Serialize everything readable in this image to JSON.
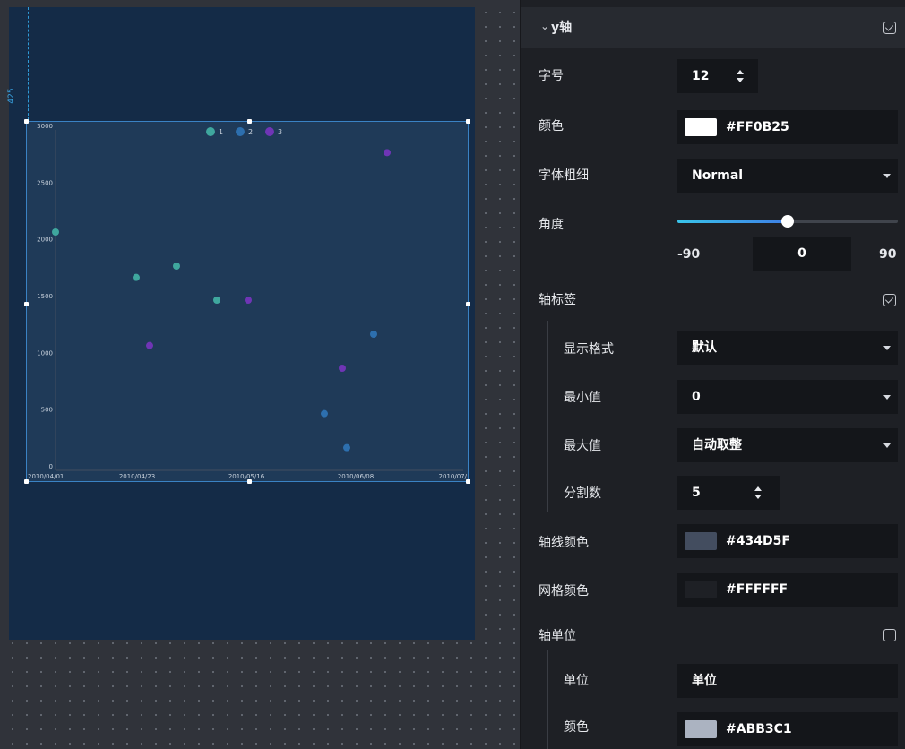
{
  "canvas": {
    "guide_label": "425"
  },
  "chart_data": {
    "type": "scatter",
    "x_tick_labels": [
      "2010/04/01",
      "2010/04/23",
      "2010/05/16",
      "2010/06/08",
      "2010/07/"
    ],
    "y_tick_labels": [
      "0",
      "500",
      "1000",
      "1500",
      "2000",
      "2500",
      "3000"
    ],
    "ylim": [
      0,
      3000
    ],
    "grid": false,
    "legend_position": "top",
    "legend": [
      {
        "name": "1",
        "color": "#3fa79e"
      },
      {
        "name": "2",
        "color": "#2d6fae"
      },
      {
        "name": "3",
        "color": "#6f35b5"
      }
    ],
    "series": [
      {
        "name": "1",
        "color": "#3fa79e",
        "points": [
          {
            "x": "2010/04/01",
            "y": 2100
          },
          {
            "x": "2010/04/19",
            "y": 1700
          },
          {
            "x": "2010/04/28",
            "y": 1800
          },
          {
            "x": "2010/05/07",
            "y": 1500
          }
        ]
      },
      {
        "name": "2",
        "color": "#2d6fae",
        "points": [
          {
            "x": "2010/05/31",
            "y": 500
          },
          {
            "x": "2010/06/05",
            "y": 200
          },
          {
            "x": "2010/06/11",
            "y": 1200
          }
        ]
      },
      {
        "name": "3",
        "color": "#6f35b5",
        "points": [
          {
            "x": "2010/04/22",
            "y": 1100
          },
          {
            "x": "2010/05/14",
            "y": 1500
          },
          {
            "x": "2010/06/04",
            "y": 900
          },
          {
            "x": "2010/06/14",
            "y": 2800
          }
        ]
      }
    ]
  },
  "panel": {
    "section_title": "y轴",
    "section_checked": true,
    "font_size": {
      "label": "字号",
      "value": "12"
    },
    "color": {
      "label": "颜色",
      "value": "#FF0B25",
      "swatch": "#ffffff"
    },
    "font_weight": {
      "label": "字体粗细",
      "value": "Normal"
    },
    "angle": {
      "label": "角度",
      "min": "-90",
      "value": "0",
      "max": "90",
      "fraction": 0.5
    },
    "axis_label": {
      "label": "轴标签",
      "checked": true
    },
    "display_format": {
      "label": "显示格式",
      "value": "默认"
    },
    "min_value": {
      "label": "最小值",
      "value": "0"
    },
    "max_value": {
      "label": "最大值",
      "value": "自动取整"
    },
    "splits": {
      "label": "分割数",
      "value": "5"
    },
    "axis_line_color": {
      "label": "轴线颜色",
      "value": "#434D5F",
      "swatch": "#434d5f"
    },
    "grid_color": {
      "label": "网格颜色",
      "value": "#FFFFFF",
      "swatch": "#1e2025"
    },
    "axis_unit": {
      "label": "轴单位",
      "checked": false
    },
    "unit": {
      "label": "单位",
      "value": "单位"
    },
    "unit_color": {
      "label": "颜色",
      "value": "#ABB3C1",
      "swatch": "#abb3c1"
    }
  }
}
